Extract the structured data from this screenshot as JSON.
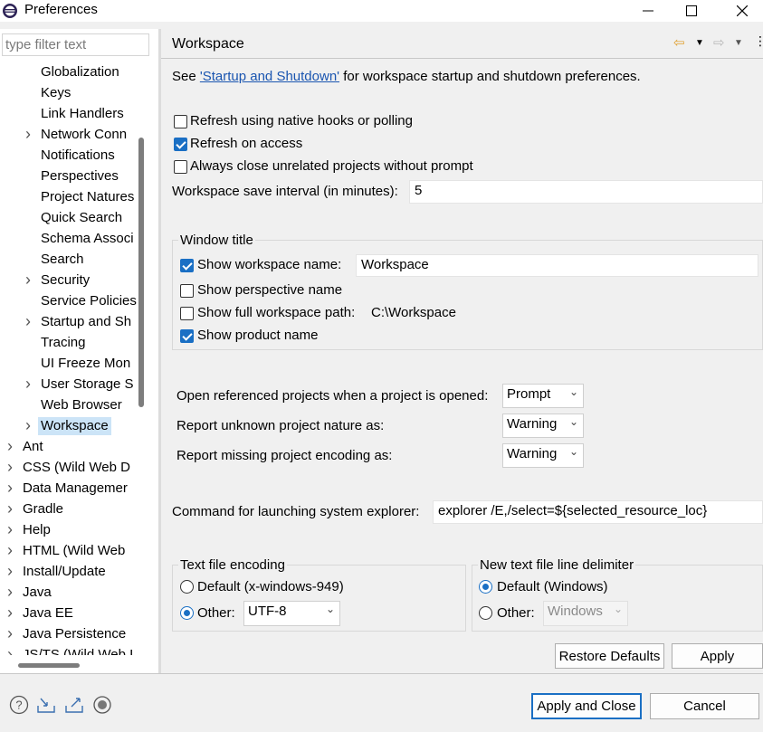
{
  "window": {
    "title": "Preferences",
    "minimize": "—",
    "maximize": "☐",
    "close": "✕"
  },
  "filter": {
    "placeholder": "type filter text"
  },
  "tree": {
    "items": [
      {
        "label": "Globalization",
        "indent": 2,
        "arrow": false
      },
      {
        "label": "Keys",
        "indent": 2,
        "arrow": false
      },
      {
        "label": "Link Handlers",
        "indent": 2,
        "arrow": false
      },
      {
        "label": "Network Conn",
        "indent": 2,
        "arrow": true
      },
      {
        "label": "Notifications",
        "indent": 2,
        "arrow": false
      },
      {
        "label": "Perspectives",
        "indent": 2,
        "arrow": false
      },
      {
        "label": "Project Natures",
        "indent": 2,
        "arrow": false
      },
      {
        "label": "Quick Search",
        "indent": 2,
        "arrow": false
      },
      {
        "label": "Schema Associ",
        "indent": 2,
        "arrow": false
      },
      {
        "label": "Search",
        "indent": 2,
        "arrow": false
      },
      {
        "label": "Security",
        "indent": 2,
        "arrow": true
      },
      {
        "label": "Service Policies",
        "indent": 2,
        "arrow": false
      },
      {
        "label": "Startup and Sh",
        "indent": 2,
        "arrow": true
      },
      {
        "label": "Tracing",
        "indent": 2,
        "arrow": false
      },
      {
        "label": "UI Freeze Mon",
        "indent": 2,
        "arrow": false
      },
      {
        "label": "User Storage S",
        "indent": 2,
        "arrow": true
      },
      {
        "label": "Web Browser",
        "indent": 2,
        "arrow": false
      },
      {
        "label": "Workspace",
        "indent": 2,
        "arrow": true,
        "selected": true
      },
      {
        "label": "Ant",
        "indent": 1,
        "arrow": true
      },
      {
        "label": "CSS (Wild Web D",
        "indent": 1,
        "arrow": true
      },
      {
        "label": "Data Managemer",
        "indent": 1,
        "arrow": true
      },
      {
        "label": "Gradle",
        "indent": 1,
        "arrow": true
      },
      {
        "label": "Help",
        "indent": 1,
        "arrow": true
      },
      {
        "label": "HTML (Wild Web",
        "indent": 1,
        "arrow": true
      },
      {
        "label": "Install/Update",
        "indent": 1,
        "arrow": true
      },
      {
        "label": "Java",
        "indent": 1,
        "arrow": true
      },
      {
        "label": "Java EE",
        "indent": 1,
        "arrow": true
      },
      {
        "label": "Java Persistence",
        "indent": 1,
        "arrow": true
      },
      {
        "label": "JS/TS (Wild Web I",
        "indent": 1,
        "arrow": true
      }
    ]
  },
  "page": {
    "title": "Workspace",
    "intro_prefix": "See ",
    "intro_link": "'Startup and Shutdown'",
    "intro_suffix": " for workspace startup and shutdown preferences.",
    "refresh_native": {
      "label": "Refresh using native hooks or polling",
      "checked": false
    },
    "refresh_access": {
      "label": "Refresh on access",
      "checked": true
    },
    "always_close": {
      "label": "Always close unrelated projects without prompt",
      "checked": false
    },
    "save_interval": {
      "label": "Workspace save interval (in minutes):",
      "value": "5"
    },
    "window_title": {
      "group_label": "Window title",
      "show_workspace_name": {
        "label": "Show workspace name:",
        "checked": true,
        "value": "Workspace"
      },
      "show_perspective_name": {
        "label": "Show perspective name",
        "checked": false
      },
      "show_full_path": {
        "label": "Show full workspace path:",
        "checked": false,
        "value": "C:\\Workspace"
      },
      "show_product_name": {
        "label": "Show product name",
        "checked": true
      }
    },
    "open_referenced": {
      "label": "Open referenced projects when a project is opened:",
      "value": "Prompt"
    },
    "report_unknown": {
      "label": "Report unknown project nature as:",
      "value": "Warning"
    },
    "report_missing": {
      "label": "Report missing project encoding as:",
      "value": "Warning"
    },
    "explorer_cmd": {
      "label": "Command for launching system explorer:",
      "value": "explorer /E,/select=${selected_resource_loc}"
    },
    "text_encoding": {
      "group_label": "Text file encoding",
      "default_label": "Default (x-windows-949)",
      "other_label": "Other:",
      "other_value": "UTF-8",
      "selected": "other"
    },
    "line_delimiter": {
      "group_label": "New text file line delimiter",
      "default_label": "Default (Windows)",
      "other_label": "Other:",
      "other_value": "Windows",
      "selected": "default"
    },
    "restore_defaults": "Restore Defaults",
    "apply": "Apply"
  },
  "footer": {
    "apply_close": "Apply and Close",
    "cancel": "Cancel",
    "icons": [
      "help-icon",
      "import-icon",
      "export-icon",
      "record-icon"
    ]
  },
  "colors": {
    "accent": "#1a6fc4",
    "link": "#1a55b0",
    "selection": "#cce4f7"
  }
}
